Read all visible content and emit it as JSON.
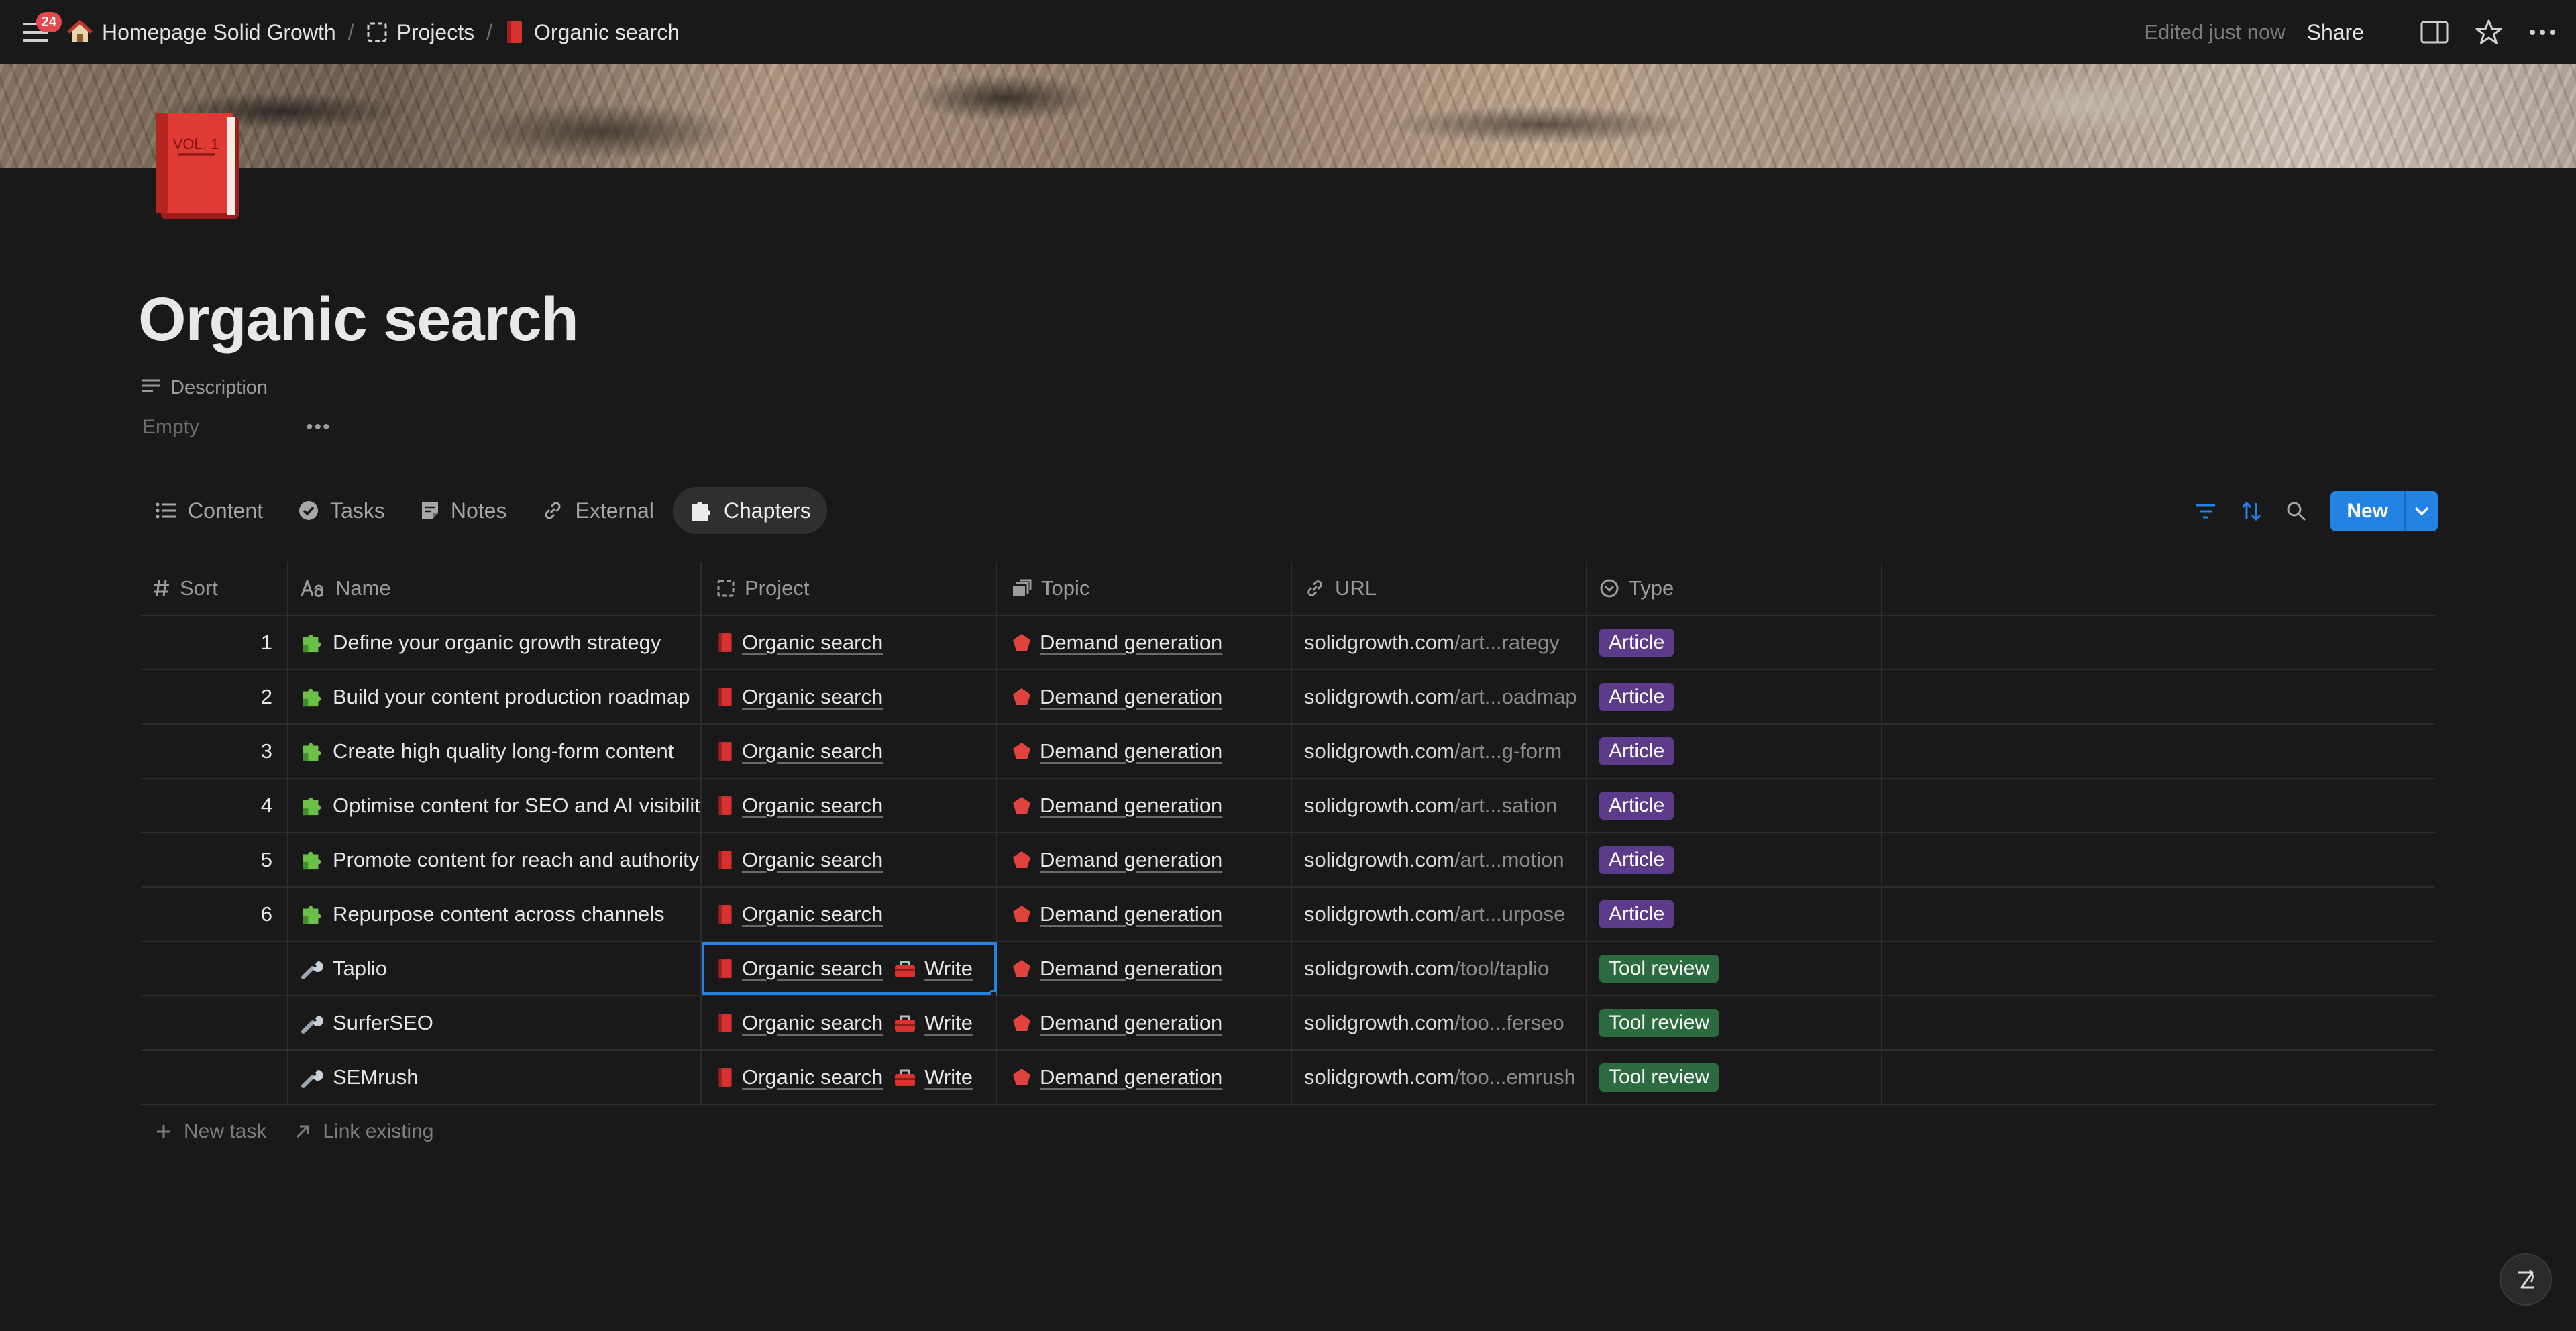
{
  "topbar": {
    "notification_count": "24",
    "breadcrumbs": [
      {
        "label": "Homepage Solid Growth",
        "icon": "house-icon"
      },
      {
        "label": "Projects",
        "icon": "dashed-square-icon"
      },
      {
        "label": "Organic search",
        "icon": "red-book-icon"
      }
    ],
    "edited": "Edited just now",
    "share_label": "Share"
  },
  "page": {
    "title": "Organic search",
    "icon": "red-book-vol1-icon",
    "description_label": "Description",
    "description_value": "Empty",
    "more_label": "•••"
  },
  "tabs": [
    {
      "label": "Content",
      "icon": "list-icon"
    },
    {
      "label": "Tasks",
      "icon": "check-circle-icon"
    },
    {
      "label": "Notes",
      "icon": "note-icon"
    },
    {
      "label": "External",
      "icon": "link-icon"
    },
    {
      "label": "Chapters",
      "icon": "puzzle-icon",
      "active": true
    }
  ],
  "toolbar": {
    "new_label": "New"
  },
  "table": {
    "columns": [
      {
        "label": "Sort",
        "icon": "hash-icon"
      },
      {
        "label": "Name",
        "icon": "text-aa-icon"
      },
      {
        "label": "Project",
        "icon": "dashed-square-icon"
      },
      {
        "label": "Topic",
        "icon": "stack-icon"
      },
      {
        "label": "URL",
        "icon": "link-icon"
      },
      {
        "label": "Type",
        "icon": "select-circle-icon"
      }
    ],
    "rows": [
      {
        "sort": "1",
        "name": "Define your organic growth strategy",
        "name_icon": "puzzle-piece-icon",
        "project": "Organic search",
        "project_extra": "",
        "topic": "Demand generation",
        "url_main": "solidgrowth.com",
        "url_rest": "/art...rategy",
        "type": "Article"
      },
      {
        "sort": "2",
        "name": "Build your content production roadmap",
        "name_icon": "puzzle-piece-icon",
        "project": "Organic search",
        "project_extra": "",
        "topic": "Demand generation",
        "url_main": "solidgrowth.com",
        "url_rest": "/art...oadmap",
        "type": "Article"
      },
      {
        "sort": "3",
        "name": "Create high quality long-form content",
        "name_icon": "puzzle-piece-icon",
        "project": "Organic search",
        "project_extra": "",
        "topic": "Demand generation",
        "url_main": "solidgrowth.com",
        "url_rest": "/art...g-form",
        "type": "Article"
      },
      {
        "sort": "4",
        "name": "Optimise content for SEO and AI visibility",
        "name_icon": "puzzle-piece-icon",
        "project": "Organic search",
        "project_extra": "",
        "topic": "Demand generation",
        "url_main": "solidgrowth.com",
        "url_rest": "/art...sation",
        "type": "Article"
      },
      {
        "sort": "5",
        "name": "Promote content for reach and authority",
        "name_icon": "puzzle-piece-icon",
        "project": "Organic search",
        "project_extra": "",
        "topic": "Demand generation",
        "url_main": "solidgrowth.com",
        "url_rest": "/art...motion",
        "type": "Article"
      },
      {
        "sort": "6",
        "name": "Repurpose content across channels",
        "name_icon": "puzzle-piece-icon",
        "project": "Organic search",
        "project_extra": "",
        "topic": "Demand generation",
        "url_main": "solidgrowth.com",
        "url_rest": "/art...urpose",
        "type": "Article"
      },
      {
        "sort": "",
        "name": "Taplio",
        "name_icon": "wrench-icon",
        "project": "Organic search",
        "project_extra": "Write",
        "topic": "Demand generation",
        "url_main": "solidgrowth.com",
        "url_rest": "/tool/taplio",
        "type": "Tool review",
        "selected": true
      },
      {
        "sort": "",
        "name": "SurferSEO",
        "name_icon": "wrench-icon",
        "project": "Organic search",
        "project_extra": "Write",
        "topic": "Demand generation",
        "url_main": "solidgrowth.com",
        "url_rest": "/too...ferseo",
        "type": "Tool review"
      },
      {
        "sort": "",
        "name": "SEMrush",
        "name_icon": "wrench-icon",
        "project": "Organic search",
        "project_extra": "Write",
        "topic": "Demand generation",
        "url_main": "solidgrowth.com",
        "url_rest": "/too...emrush",
        "type": "Tool review"
      }
    ]
  },
  "footer": {
    "new_task": "New task",
    "link_existing": "Link existing"
  },
  "colors": {
    "accent": "#2383e2",
    "article_tag": "#5b3b8a",
    "tool_tag": "#2b6b3f",
    "background": "#191919"
  }
}
